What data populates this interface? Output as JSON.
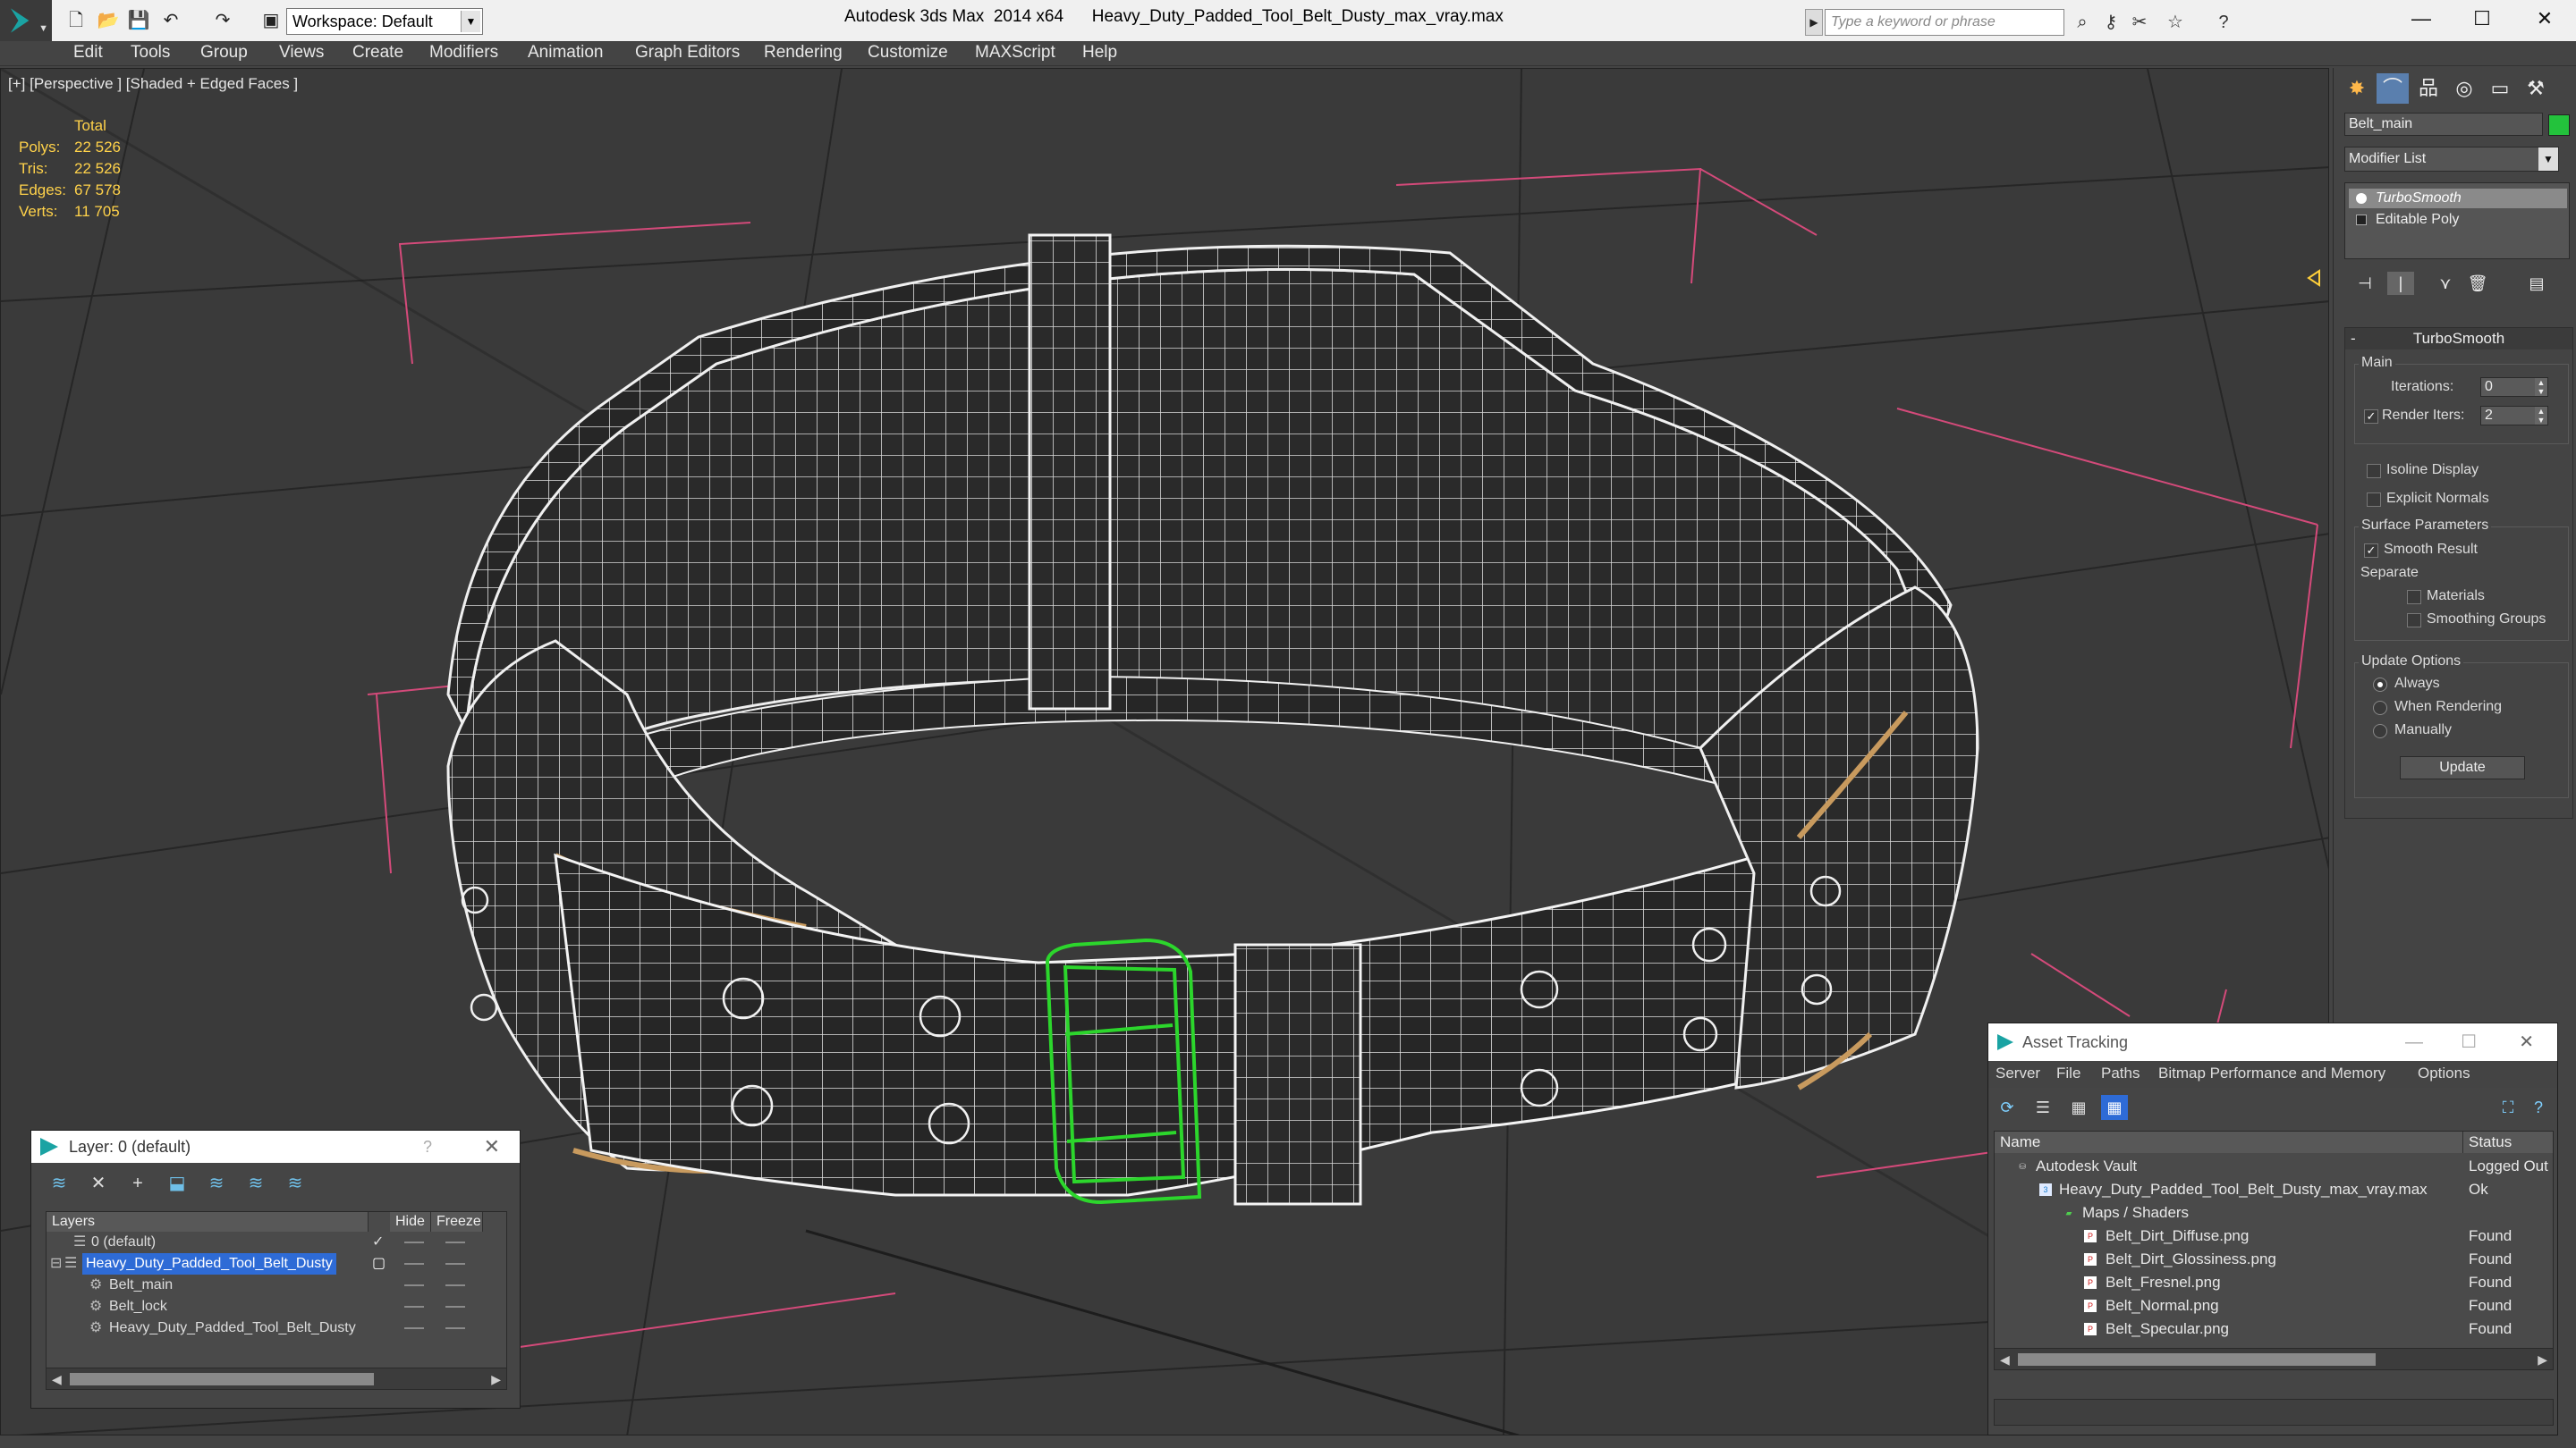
{
  "titlebar": {
    "workspace": "Workspace: Default",
    "app_title": "Autodesk 3ds Max  2014 x64",
    "file_title": "Heavy_Duty_Padded_Tool_Belt_Dusty_max_vray.max",
    "search_placeholder": "Type a keyword or phrase"
  },
  "menu": [
    "Edit",
    "Tools",
    "Group",
    "Views",
    "Create",
    "Modifiers",
    "Animation",
    "Graph Editors",
    "Rendering",
    "Customize",
    "MAXScript",
    "Help"
  ],
  "viewport": {
    "label": "[+] [Perspective ] [Shaded + Edged Faces ]",
    "stats": {
      "header": "Total",
      "rows": [
        {
          "label": "Polys:",
          "value": "22 526"
        },
        {
          "label": "Tris:",
          "value": "22 526"
        },
        {
          "label": "Edges:",
          "value": "67 578"
        },
        {
          "label": "Verts:",
          "value": "11 705"
        }
      ]
    }
  },
  "command_panel": {
    "object_name": "Belt_main",
    "object_color": "#23c23c",
    "modifier_list": "Modifier List",
    "stack": [
      "TurboSmooth",
      "Editable Poly"
    ],
    "rollout_title": "TurboSmooth",
    "main_group": "Main",
    "iterations_label": "Iterations:",
    "iterations_value": "0",
    "render_iters_label": "Render Iters:",
    "render_iters_value": "2",
    "isoline_display": "Isoline Display",
    "explicit_normals": "Explicit Normals",
    "surface_group": "Surface Parameters",
    "smooth_result": "Smooth Result",
    "separate_label": "Separate",
    "materials": "Materials",
    "smoothing_groups": "Smoothing Groups",
    "update_group": "Update Options",
    "always": "Always",
    "when_rendering": "When Rendering",
    "manually": "Manually",
    "update_button": "Update"
  },
  "layer_dialog": {
    "title": "Layer: 0 (default)",
    "help": "?",
    "columns": [
      "Layers",
      "Hide",
      "Freeze"
    ],
    "rows": [
      {
        "name": "0 (default)",
        "indent": 1
      },
      {
        "name": "Heavy_Duty_Padded_Tool_Belt_Dusty",
        "indent": 0,
        "selected": true
      },
      {
        "name": "Belt_main",
        "indent": 2
      },
      {
        "name": "Belt_lock",
        "indent": 2
      },
      {
        "name": "Heavy_Duty_Padded_Tool_Belt_Dusty",
        "indent": 2
      }
    ]
  },
  "asset_dialog": {
    "title": "Asset Tracking",
    "menu": [
      "Server",
      "File",
      "Paths",
      "Bitmap Performance and Memory",
      "Options"
    ],
    "columns": [
      "Name",
      "Status"
    ],
    "rows": [
      {
        "name": "Autodesk Vault",
        "status": "Logged Out",
        "indent": 0,
        "icon": "vault"
      },
      {
        "name": "Heavy_Duty_Padded_Tool_Belt_Dusty_max_vray.max",
        "status": "Ok",
        "indent": 1,
        "icon": "max"
      },
      {
        "name": "Maps / Shaders",
        "status": "",
        "indent": 2,
        "icon": "folder"
      },
      {
        "name": "Belt_Dirt_Diffuse.png",
        "status": "Found",
        "indent": 3,
        "icon": "png"
      },
      {
        "name": "Belt_Dirt_Glossiness.png",
        "status": "Found",
        "indent": 3,
        "icon": "png"
      },
      {
        "name": "Belt_Fresnel.png",
        "status": "Found",
        "indent": 3,
        "icon": "png"
      },
      {
        "name": "Belt_Normal.png",
        "status": "Found",
        "indent": 3,
        "icon": "png"
      },
      {
        "name": "Belt_Specular.png",
        "status": "Found",
        "indent": 3,
        "icon": "png"
      }
    ]
  }
}
